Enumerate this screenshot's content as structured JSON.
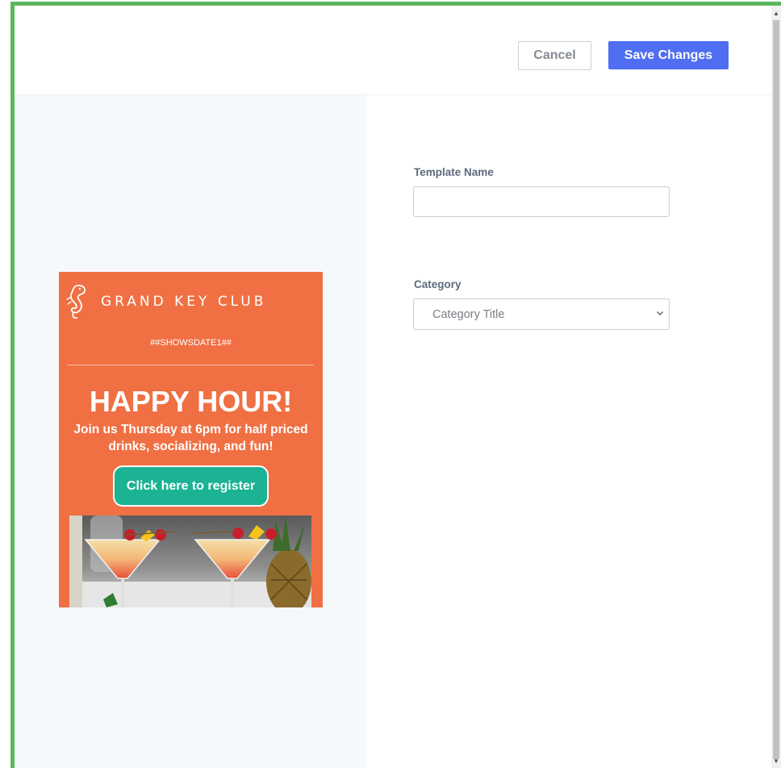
{
  "header": {
    "cancel_label": "Cancel",
    "save_label": "Save Changes"
  },
  "form": {
    "template_name_label": "Template Name",
    "template_name_value": "",
    "category_label": "Category",
    "category_selected": "Category Title"
  },
  "preview": {
    "brand": "GRAND KEY CLUB",
    "shows_date": "##SHOWSDATE1##",
    "headline": "HAPPY HOUR!",
    "subtext": "Join us Thursday at 6pm for half priced drinks, socializing, and fun!",
    "register_label": "Click here to register",
    "icons": [
      "seahorse-logo-icon",
      "cocktail-photo"
    ]
  },
  "colors": {
    "frame_accent": "#5cb85c",
    "primary_button": "#4f6ef2",
    "preview_background": "#f07044",
    "register_button": "#1bb394",
    "left_panel": "#f6f9fb"
  }
}
